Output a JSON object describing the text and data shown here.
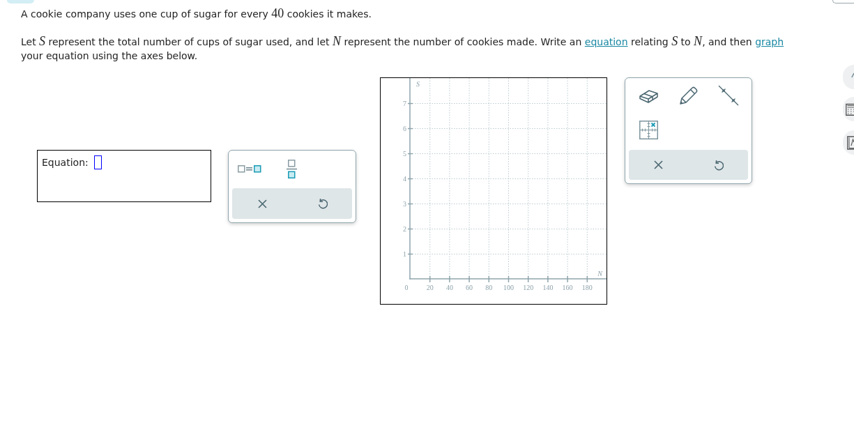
{
  "question": {
    "paragraphs": [
      {
        "parts": [
          {
            "kind": "text",
            "text": "A cookie company uses one cup of sugar for every "
          },
          {
            "kind": "number",
            "text": "40"
          },
          {
            "kind": "text",
            "text": " cookies it makes."
          }
        ]
      },
      {
        "parts": [
          {
            "kind": "text",
            "text": "Let "
          },
          {
            "kind": "variable",
            "text": "S"
          },
          {
            "kind": "text",
            "text": " represent the total number of cups of sugar used, and let "
          },
          {
            "kind": "variable",
            "text": "N"
          },
          {
            "kind": "text",
            "text": " represent the number of cookies made. Write an "
          },
          {
            "kind": "link",
            "text": "equation"
          },
          {
            "kind": "text",
            "text": " relating "
          },
          {
            "kind": "variable",
            "text": "S"
          },
          {
            "kind": "text",
            "text": " to "
          },
          {
            "kind": "variable",
            "text": "N"
          },
          {
            "kind": "text",
            "text": ", and then "
          },
          {
            "kind": "link",
            "text": "graph"
          },
          {
            "kind": "text",
            "text": " your equation using the axes below."
          }
        ]
      }
    ]
  },
  "equation_editor": {
    "label": "Equation:"
  },
  "graph": {
    "origin_label": "0",
    "chart_data": {
      "type": "line",
      "xlabel": "N",
      "ylabel": "S",
      "xlim": [
        0,
        200
      ],
      "ylim": [
        0,
        8
      ],
      "xticks": [
        20,
        40,
        60,
        80,
        100,
        120,
        140,
        160,
        180
      ],
      "yticks": [
        1,
        2,
        3,
        4,
        5,
        6,
        7
      ],
      "grid": true
    }
  }
}
